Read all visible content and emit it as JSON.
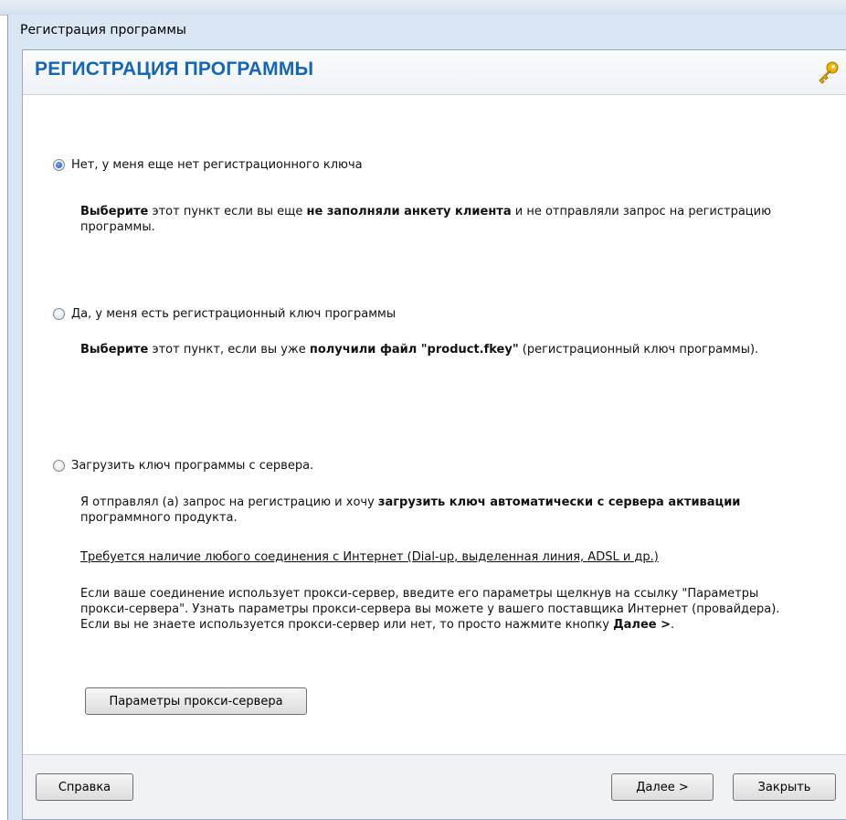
{
  "window": {
    "title": "Регистрация программы"
  },
  "header": {
    "title": "РЕГИСТРАЦИЯ ПРОГРАММЫ",
    "icon": "key-icon"
  },
  "options": [
    {
      "label": "Нет, у меня еще нет регистрационного ключа",
      "checked": true,
      "desc": [
        {
          "b": "Выберите"
        },
        {
          "t": " этот пункт если вы еще "
        },
        {
          "b": "не заполняли анкету клиента"
        },
        {
          "t": " и не отправляли запрос на регистрацию программы."
        }
      ]
    },
    {
      "label": "Да, у меня есть регистрационный ключ программы",
      "checked": false,
      "desc": [
        {
          "b": "Выберите"
        },
        {
          "t": " этот пункт, если вы уже "
        },
        {
          "b": "получили файл \"product.fkey\""
        },
        {
          "t": " (регистрационный ключ программы)."
        }
      ]
    },
    {
      "label": "Загрузить ключ программы с сервера.",
      "checked": false,
      "desc": [
        {
          "t": "Я отправлял (а) запрос на регистрацию и хочу "
        },
        {
          "b": "загрузить ключ автоматически с сервера активации"
        },
        {
          "t": " программного продукта."
        }
      ],
      "note": "Требуется наличие любого соединения с Интернет (Dial-up, выделенная линия, ADSL и др.)",
      "proxy_text": [
        {
          "t": "Если ваше соединение использует прокси-сервер, введите его параметры щелкнув на ссылку \"Параметры прокси-сервера\". Узнать параметры прокси-сервера вы можете у вашего поставщика Интернет (провайдера). Если вы не знаете используется прокси-сервер или нет, то просто нажмите кнопку "
        },
        {
          "b": "Далее >"
        },
        {
          "t": "."
        }
      ]
    }
  ],
  "buttons": {
    "proxy": "Параметры прокси-сервера",
    "help": "Справка",
    "next": "Далее >",
    "close": "Закрыть"
  },
  "colors": {
    "header_title": "#1566b6",
    "key": "#f0b400"
  }
}
